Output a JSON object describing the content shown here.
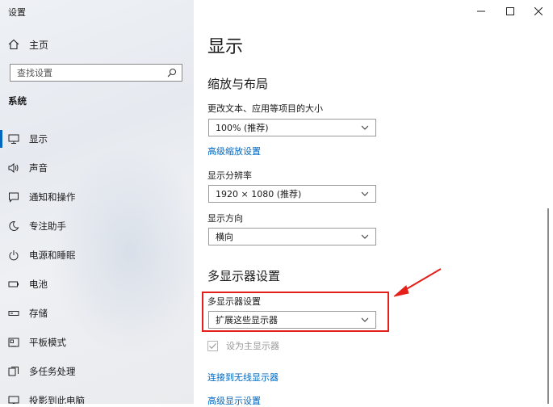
{
  "window": {
    "title": "设置"
  },
  "sidebar": {
    "home_label": "主页",
    "search_placeholder": "查找设置",
    "section": "系统",
    "items": [
      {
        "label": "显示",
        "icon": "monitor-icon",
        "active": true
      },
      {
        "label": "声音",
        "icon": "speaker-icon"
      },
      {
        "label": "通知和操作",
        "icon": "notification-icon"
      },
      {
        "label": "专注助手",
        "icon": "moon-icon"
      },
      {
        "label": "电源和睡眠",
        "icon": "power-icon"
      },
      {
        "label": "电池",
        "icon": "battery-icon"
      },
      {
        "label": "存储",
        "icon": "storage-icon"
      },
      {
        "label": "平板模式",
        "icon": "tablet-icon"
      },
      {
        "label": "多任务处理",
        "icon": "multitask-icon"
      },
      {
        "label": "投影到此电脑",
        "icon": "project-icon"
      }
    ]
  },
  "main": {
    "title": "显示",
    "scale_section": {
      "heading": "缩放与布局",
      "text_size_label": "更改文本、应用等项目的大小",
      "text_size_value": "100% (推荐)",
      "advanced_scale_link": "高级缩放设置",
      "resolution_label": "显示分辨率",
      "resolution_value": "1920 × 1080 (推荐)",
      "orientation_label": "显示方向",
      "orientation_value": "横向"
    },
    "multi_section": {
      "heading": "多显示器设置",
      "label": "多显示器设置",
      "value": "扩展这些显示器",
      "primary_checkbox_label": "设为主显示器",
      "primary_checked": true,
      "wireless_link": "连接到无线显示器",
      "advanced_display_link": "高级显示设置"
    }
  },
  "colors": {
    "accent": "#0067c0",
    "annotation": "#e5201b"
  }
}
